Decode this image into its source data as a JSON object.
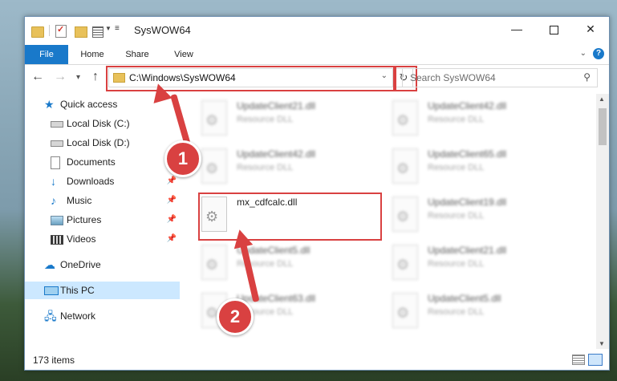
{
  "window": {
    "title": "SysWOW64",
    "minimize_glyph": "—",
    "close_glyph": "✕"
  },
  "ribbon": {
    "tabs": [
      {
        "label": "File"
      },
      {
        "label": "Home"
      },
      {
        "label": "Share"
      },
      {
        "label": "View"
      }
    ],
    "help_glyph": "?"
  },
  "nav": {
    "address": "C:\\Windows\\SysWOW64",
    "search_placeholder": "Search SysWOW64"
  },
  "sidebar": {
    "items": [
      {
        "label": "Quick access",
        "icon": "star-icon"
      },
      {
        "label": "Local Disk (C:)",
        "icon": "drive-icon"
      },
      {
        "label": "Local Disk (D:)",
        "icon": "drive-icon"
      },
      {
        "label": "Documents",
        "icon": "documents-icon"
      },
      {
        "label": "Downloads",
        "icon": "download-icon"
      },
      {
        "label": "Music",
        "icon": "music-icon"
      },
      {
        "label": "Pictures",
        "icon": "pictures-icon"
      },
      {
        "label": "Videos",
        "icon": "videos-icon"
      },
      {
        "label": "OneDrive",
        "icon": "cloud-icon"
      },
      {
        "label": "This PC",
        "icon": "computer-icon",
        "selected": true
      },
      {
        "label": "Network",
        "icon": "network-icon"
      }
    ]
  },
  "files": [
    {
      "name": "UpdateClient21.dll",
      "type": "Resource DLL"
    },
    {
      "name": "UpdateClient42.dll",
      "type": "Resource DLL"
    },
    {
      "name": "UpdateClient42.dll",
      "type": "Resource DLL"
    },
    {
      "name": "UpdateClient65.dll",
      "type": "Resource DLL"
    },
    {
      "name": "mx_cdfcalc.dll",
      "type": "",
      "highlighted": true
    },
    {
      "name": "UpdateClient19.dll",
      "type": "Resource DLL"
    },
    {
      "name": "UpdateClient5.dll",
      "type": "Resource DLL"
    },
    {
      "name": "UpdateClient21.dll",
      "type": "Resource DLL"
    },
    {
      "name": "UpdateClient63.dll",
      "type": "Resource DLL"
    },
    {
      "name": "UpdateClient5.dll",
      "type": "Resource DLL"
    }
  ],
  "status": {
    "item_count": "173 items"
  },
  "annotations": {
    "step1": "1",
    "step2": "2",
    "accent_color": "#d94141"
  },
  "colors": {
    "file_tab": "#1979ca",
    "selection": "#cce8ff"
  }
}
